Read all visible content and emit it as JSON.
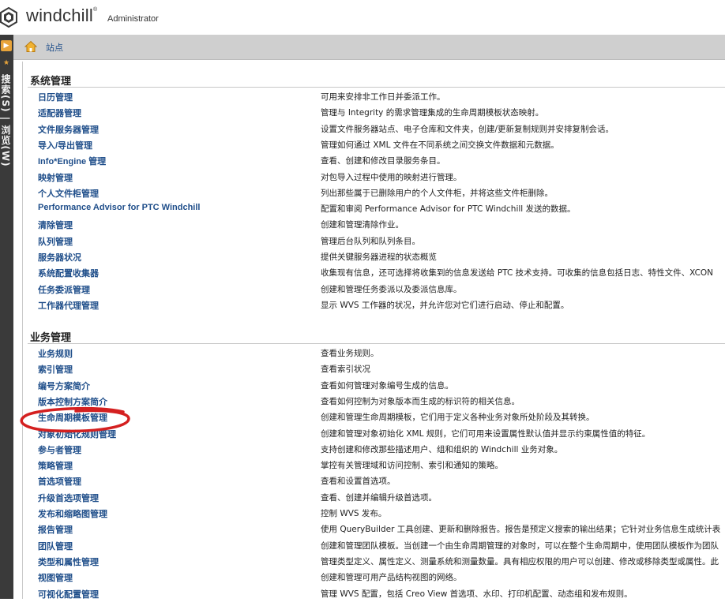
{
  "header": {
    "brand": "windchill",
    "trademark": "®",
    "user": "Administrator"
  },
  "rail": {
    "label": "搜索(S) | 浏览(W)"
  },
  "breadcrumb": {
    "label": "站点"
  },
  "colors": {
    "link": "#1f4e8a",
    "rail": "#3a3a3a",
    "accent": "#e8a43a",
    "annotation": "#d42020"
  },
  "sections": [
    {
      "title": "系统管理",
      "items": [
        {
          "name": "日历管理",
          "desc": "可用来安排非工作日并委派工作。"
        },
        {
          "name": "适配器管理",
          "desc": "管理与 Integrity 的需求管理集成的生命周期模板状态映射。"
        },
        {
          "name": "文件服务器管理",
          "desc": "设置文件服务器站点、电子仓库和文件夹，创建/更新复制规则并安排复制会话。"
        },
        {
          "name": "导入/导出管理",
          "desc": "管理如何通过 XML 文件在不同系统之间交换文件数据和元数据。"
        },
        {
          "name": "Info*Engine 管理",
          "desc": "查看、创建和修改目录服务条目。"
        },
        {
          "name": "映射管理",
          "desc": "对包导入过程中使用的映射进行管理。"
        },
        {
          "name": "个人文件柜管理",
          "desc": "列出那些属于已删除用户的个人文件柜，并将这些文件柜删除。"
        },
        {
          "name": "Performance Advisor for PTC Windchill",
          "desc": "配置和审阅 Performance Advisor for PTC Windchill 发送的数据。"
        },
        {
          "name": "清除管理",
          "desc": "创建和管理清除作业。"
        },
        {
          "name": "队列管理",
          "desc": "管理后台队列和队列条目。"
        },
        {
          "name": "服务器状况",
          "desc": "提供关键服务器进程的状态概览"
        },
        {
          "name": "系统配置收集器",
          "desc": "收集现有信息，还可选择将收集到的信息发送给 PTC 技术支持。可收集的信息包括日志、特性文件、XCON"
        },
        {
          "name": "任务委派管理",
          "desc": "创建和管理任务委派以及委派信息库。"
        },
        {
          "name": "工作器代理管理",
          "desc": "显示 WVS 工作器的状况，并允许您对它们进行启动、停止和配置。"
        }
      ]
    },
    {
      "title": "业务管理",
      "items": [
        {
          "name": "业务规则",
          "desc": "查看业务规则。"
        },
        {
          "name": "索引管理",
          "desc": "查看索引状况"
        },
        {
          "name": "编号方案简介",
          "desc": "查看如何管理对象编号生成的信息。"
        },
        {
          "name": "版本控制方案简介",
          "desc": "查看如何控制为对象版本而生成的标识符的相关信息。"
        },
        {
          "name": "生命周期模板管理",
          "desc": "创建和管理生命周期模板，它们用于定义各种业务对象所处阶段及其转换。"
        },
        {
          "name": "对象初始化规则管理",
          "desc": "创建和管理对象初始化 XML 规则，它们可用来设置属性默认值并显示约束属性值的特征。"
        },
        {
          "name": "参与者管理",
          "desc": "支持创建和修改那些描述用户、组和组织的 Windchill 业务对象。"
        },
        {
          "name": "策略管理",
          "desc": "掌控有关管理域和访问控制、索引和通知的策略。"
        },
        {
          "name": "首选项管理",
          "desc": "查看和设置首选项。"
        },
        {
          "name": "升级首选项管理",
          "desc": "查看、创建并编辑升级首选项。"
        },
        {
          "name": "发布和缩略图管理",
          "desc": "控制 WVS 发布。"
        },
        {
          "name": "报告管理",
          "desc": "使用 QueryBuilder 工具创建、更新和删除报告。报告是预定义搜索的输出结果；它针对业务信息生成统计表"
        },
        {
          "name": "团队管理",
          "desc": "创建和管理团队模板。当创建一个由生命周期管理的对象时，可以在整个生命周期中，使用团队模板作为团队"
        },
        {
          "name": "类型和属性管理",
          "desc": "管理类型定义、属性定义、测量系统和测量数量。具有相应权限的用户可以创建、修改或移除类型或属性。此"
        },
        {
          "name": "视图管理",
          "desc": "创建和管理可用产品结构视图的网络。"
        },
        {
          "name": "可视化配置管理",
          "desc": "管理 WVS 配置，包括 Creo View 首选项、水印、打印机配置、动态组和发布规则。"
        }
      ]
    }
  ]
}
